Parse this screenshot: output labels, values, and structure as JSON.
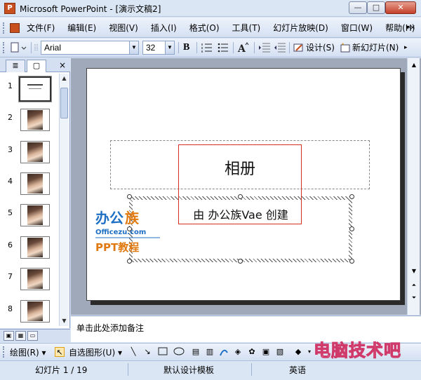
{
  "window": {
    "title": "Microsoft PowerPoint - [演示文稿2]",
    "app_icon": "P"
  },
  "window_buttons": {
    "minimize": "—",
    "maximize": "□",
    "close": "✕"
  },
  "menubar": {
    "items": [
      "文件(F)",
      "编辑(E)",
      "视图(V)",
      "插入(I)",
      "格式(O)",
      "工具(T)",
      "幻灯片放映(D)",
      "窗口(W)",
      "帮助(H)"
    ],
    "help_dropdown": "▾×"
  },
  "toolbar": {
    "font_name": "Arial",
    "font_size": "32",
    "bold": "B",
    "design_label": "设计(S)",
    "new_slide_label": "新幻灯片(N)"
  },
  "left_panel": {
    "tab_outline": "≣",
    "tab_slides": "▢",
    "close": "×",
    "slides": [
      "1",
      "2",
      "3",
      "4",
      "5",
      "6",
      "7",
      "8"
    ]
  },
  "slide": {
    "title": "相册",
    "subtitle": "由 办公族Vae 创建"
  },
  "notes": {
    "placeholder": "单击此处添加备注"
  },
  "drawing_toolbar": {
    "draw_label": "绘图(R) ▾",
    "autoshapes_label": "自选图形(U) ▾"
  },
  "statusbar": {
    "slide_position": "幻灯片 1 / 19",
    "template": "默认设计模板",
    "language": "英语"
  },
  "colors": {
    "accent_red": "#d43020",
    "watermark_blue": "#1f6fc4",
    "watermark_orange": "#e07a10",
    "watermark_pink": "#d03a6a"
  }
}
